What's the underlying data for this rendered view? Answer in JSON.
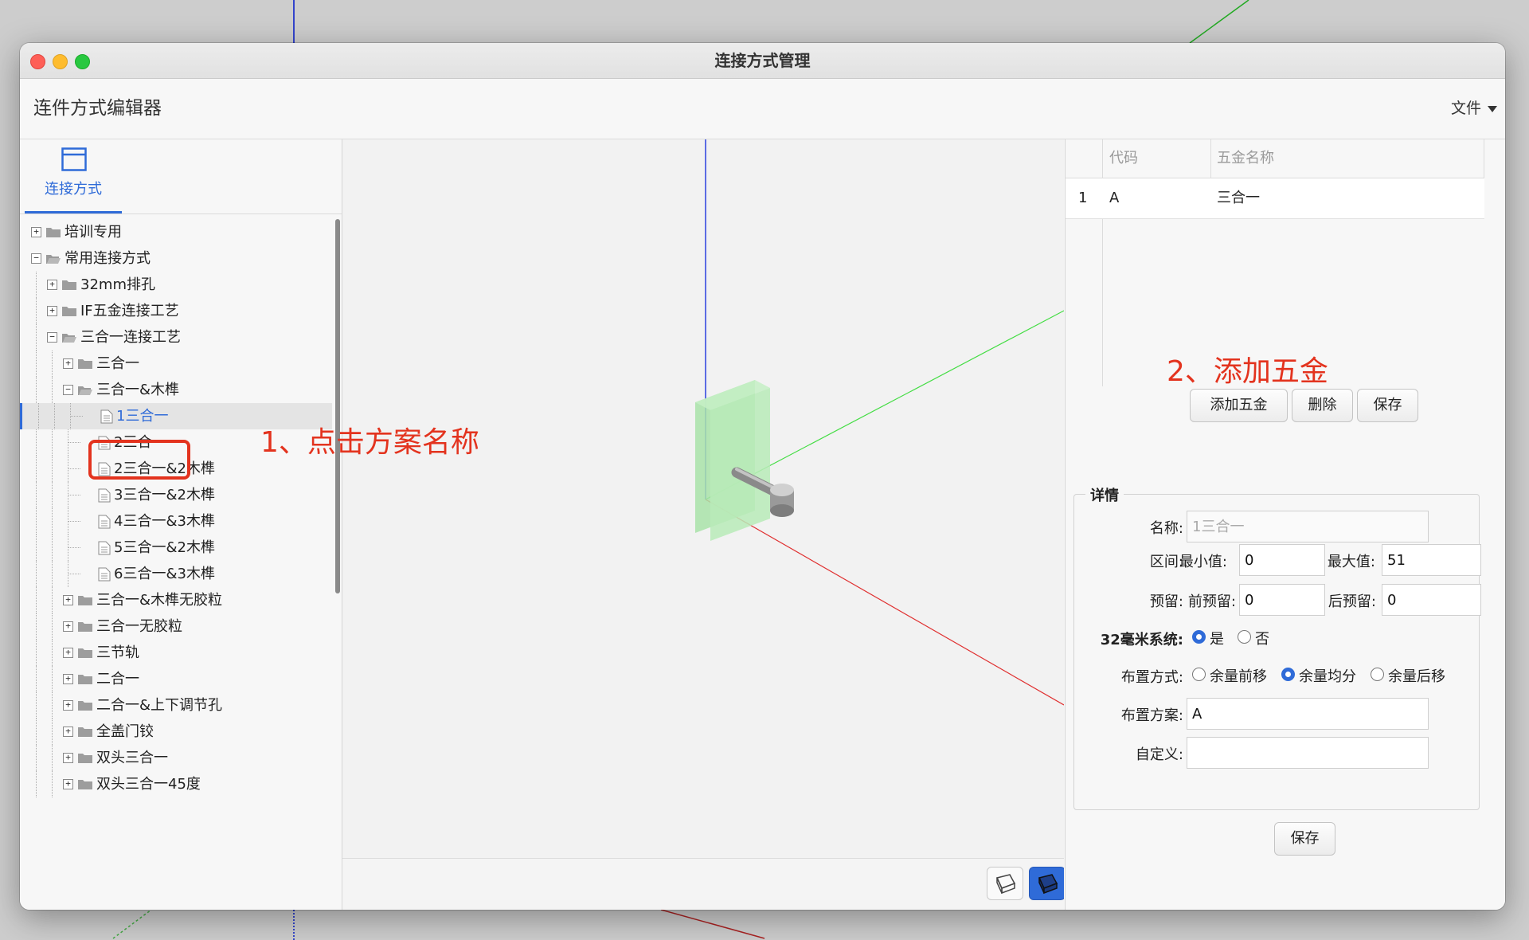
{
  "window": {
    "title": "连接方式管理"
  },
  "header": {
    "app_title": "连件方式编辑器",
    "file_menu": "文件"
  },
  "left_panel": {
    "tab_label": "连接方式",
    "tree": [
      {
        "label": "培训专用",
        "level": 0,
        "kind": "folder",
        "expanded": false
      },
      {
        "label": "常用连接方式",
        "level": 0,
        "kind": "folder",
        "expanded": true
      },
      {
        "label": "32mm排孔",
        "level": 1,
        "kind": "folder",
        "expanded": false
      },
      {
        "label": "IF五金连接工艺",
        "level": 1,
        "kind": "folder",
        "expanded": false
      },
      {
        "label": "三合一连接工艺",
        "level": 1,
        "kind": "folder",
        "expanded": true
      },
      {
        "label": "三合一",
        "level": 2,
        "kind": "folder",
        "expanded": false
      },
      {
        "label": "三合一&木榫",
        "level": 2,
        "kind": "folder",
        "expanded": true
      },
      {
        "label": "1三合一",
        "level": 3,
        "kind": "file",
        "selected": true
      },
      {
        "label": "2三合一",
        "level": 3,
        "kind": "file"
      },
      {
        "label": "2三合一&2木榫",
        "level": 3,
        "kind": "file"
      },
      {
        "label": "3三合一&2木榫",
        "level": 3,
        "kind": "file"
      },
      {
        "label": "4三合一&3木榫",
        "level": 3,
        "kind": "file"
      },
      {
        "label": "5三合一&2木榫",
        "level": 3,
        "kind": "file"
      },
      {
        "label": "6三合一&3木榫",
        "level": 3,
        "kind": "file"
      },
      {
        "label": "三合一&木榫无胶粒",
        "level": 2,
        "kind": "folder",
        "expanded": false
      },
      {
        "label": "三合一无胶粒",
        "level": 2,
        "kind": "folder",
        "expanded": false
      },
      {
        "label": "三节轨",
        "level": 2,
        "kind": "folder",
        "expanded": false
      },
      {
        "label": "二合一",
        "level": 2,
        "kind": "folder",
        "expanded": false
      },
      {
        "label": "二合一&上下调节孔",
        "level": 2,
        "kind": "folder",
        "expanded": false
      },
      {
        "label": "全盖门铰",
        "level": 2,
        "kind": "folder",
        "expanded": false
      },
      {
        "label": "双头三合一",
        "level": 2,
        "kind": "folder",
        "expanded": false
      },
      {
        "label": "双头三合一45度",
        "level": 2,
        "kind": "folder",
        "expanded": false
      }
    ]
  },
  "hardware_table": {
    "columns": [
      "代码",
      "五金名称"
    ],
    "rows": [
      {
        "index": "1",
        "code": "A",
        "name": "三合一"
      }
    ]
  },
  "buttons": {
    "add": "添加五金",
    "delete": "删除",
    "save": "保存",
    "save_bottom": "保存"
  },
  "details": {
    "legend": "详情",
    "name_label": "名称:",
    "name_value": "1三合一",
    "range_label": "区间:",
    "min_label": "最小值:",
    "min_value": "0",
    "max_label": "最大值:",
    "max_value": "51",
    "reserve_label": "预留:",
    "front_label": "前预留:",
    "front_value": "0",
    "back_label": "后预留:",
    "back_value": "0",
    "system32_label": "32毫米系统:",
    "system32_options": [
      "是",
      "否"
    ],
    "system32_selected": "是",
    "layout_label": "布置方式:",
    "layout_options": [
      "余量前移",
      "余量均分",
      "余量后移"
    ],
    "layout_selected": "余量均分",
    "scheme_label": "布置方案:",
    "scheme_value": "A",
    "custom_label": "自定义:",
    "custom_value": ""
  },
  "annotations": {
    "step1": "1、点击方案名称",
    "step2": "2、添加五金"
  },
  "colors": {
    "accent": "#2f6bd8",
    "annotation": "#e3331e"
  }
}
